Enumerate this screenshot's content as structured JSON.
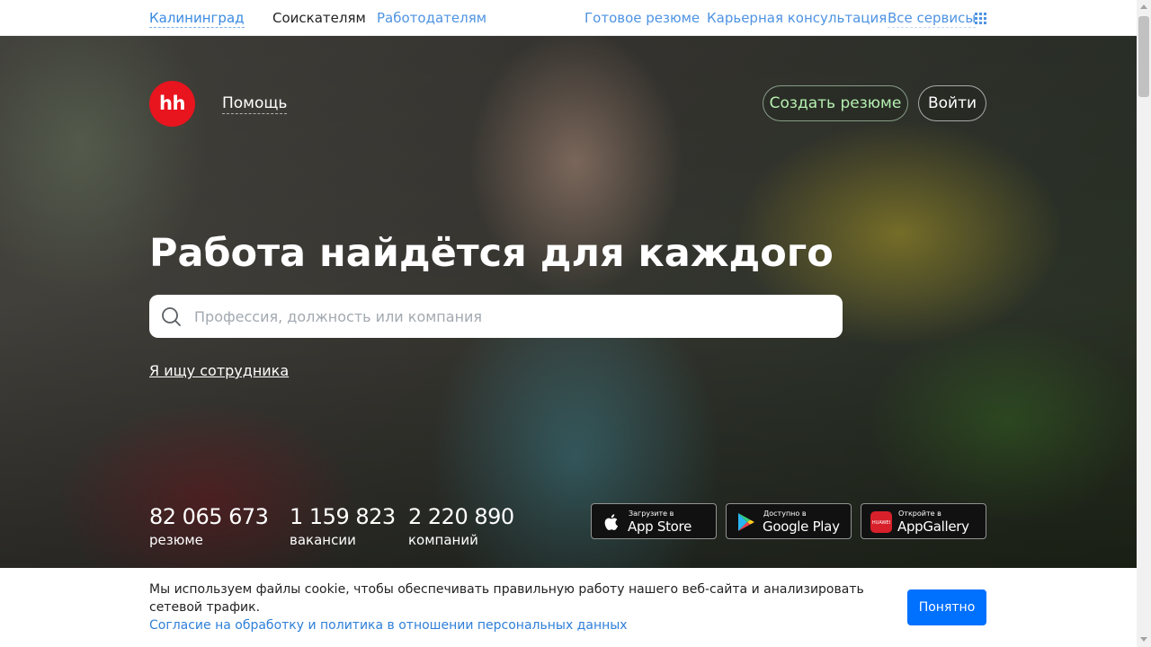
{
  "topbar": {
    "city": "Калининград",
    "seekers": "Соискателям",
    "employers": "Работодателям",
    "ready_resume": "Готовое резюме",
    "career_consult": "Карьерная консультация",
    "all_services": "Все сервисы"
  },
  "header": {
    "logo_text": "hh",
    "help": "Помощь",
    "create_resume": "Создать резюме",
    "login": "Войти"
  },
  "hero": {
    "title": "Работа найдётся для каждого",
    "search_placeholder": "Профессия, должность или компания",
    "employer_link": "Я ищу сотрудника"
  },
  "stats": [
    {
      "value": "82 065 673",
      "label": "резюме"
    },
    {
      "value": "1 159 823",
      "label": "вакансии"
    },
    {
      "value": "2 220 890",
      "label": "компаний"
    }
  ],
  "stores": [
    {
      "small": "Загрузите в",
      "name": "App Store",
      "icon": "apple-icon"
    },
    {
      "small": "Доступно в",
      "name": "Google Play",
      "icon": "google-play-icon"
    },
    {
      "small": "Откройте в",
      "name": "AppGallery",
      "icon": "huawei-icon",
      "icon_text": "HUAWEI"
    }
  ],
  "cookie": {
    "text": "Мы используем файлы cookie, чтобы обеспечивать правильную работу нашего веб-сайта и анализировать сетевой трафик.",
    "link": "Согласие на обработку и политика в отношении персональных данных",
    "ok": "Понятно"
  },
  "colors": {
    "brand_red": "#e8141e",
    "link_blue": "#4e93e2",
    "button_blue": "#0070ff",
    "create_resume_green": "#b5f0b0"
  }
}
